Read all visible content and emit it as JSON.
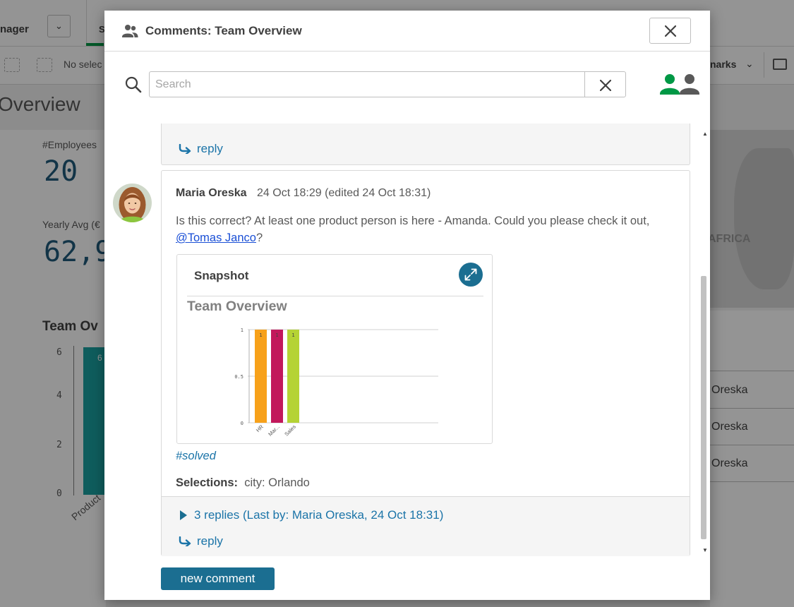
{
  "background": {
    "app_name": "nager",
    "tab_text": "S",
    "no_selections": "No selec",
    "bookmarks": "narks",
    "sheet_title": "Overview",
    "kpi1_label": "#Employees",
    "kpi1_value": "20",
    "kpi2_label": "Yearly Avg (€",
    "kpi2_value": "62,9",
    "chart_title": "Team Ov",
    "axis_ticks": [
      "6",
      "4",
      "2",
      "0"
    ],
    "bar_label": "6",
    "category_label": "Product",
    "map_label": "AFRICA",
    "table_cells": [
      "Oreska",
      "Oreska",
      "Oreska"
    ]
  },
  "dialog": {
    "title": "Comments: Team Overview",
    "search": {
      "placeholder": "Search",
      "value": ""
    },
    "colors": {
      "accent": "#1b6e91",
      "link": "#1b74a8",
      "mention": "#1a4fd6",
      "user_green": "#009845"
    }
  },
  "thread": {
    "previous_reply_label": "reply",
    "comment": {
      "author": "Maria Oreska",
      "date": "24 Oct 18:29 (edited 24 Oct 18:31)",
      "text_before": "Is this correct? At least one product person is here - Amanda. Could you please check it out, ",
      "mention": "@Tomas Janco",
      "text_after": "?",
      "snapshot": {
        "label": "Snapshot",
        "title": "Team Overview"
      },
      "tag": "#solved",
      "selections_label": "Selections:",
      "selections_value": "city: Orlando",
      "replies_summary": "3 replies (Last by: Maria Oreska, 24 Oct 18:31)",
      "reply_label": "reply"
    },
    "new_comment_label": "new comment"
  },
  "chart_data": {
    "type": "bar",
    "title": "Team Overview",
    "categories": [
      "HR",
      "Mar...",
      "Sales"
    ],
    "values": [
      1,
      1,
      1
    ],
    "data_labels": [
      "1",
      "1",
      "1"
    ],
    "colors": [
      "#f7a11a",
      "#c2185b",
      "#b5d334"
    ],
    "y_ticks": [
      "1",
      "0.5",
      "0"
    ],
    "ylim": [
      0,
      1
    ],
    "grid": true
  }
}
